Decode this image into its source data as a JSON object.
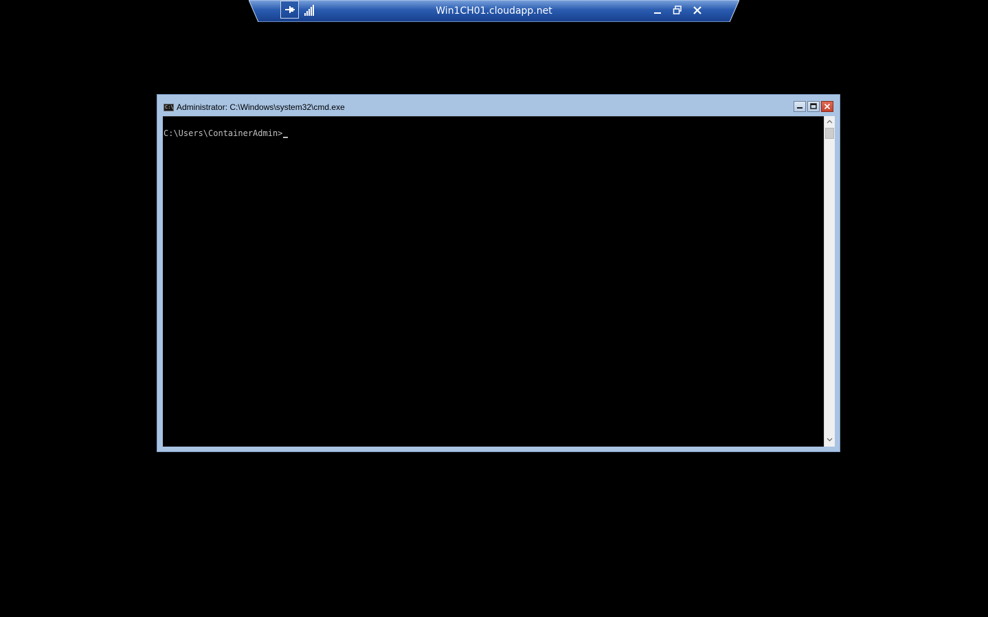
{
  "rdp_bar": {
    "title": "Win1CH01.cloudapp.net",
    "icons": {
      "pin": "pin-icon",
      "signal": "connection-signal-icon",
      "minimize": "minimize-icon",
      "restore": "restore-icon",
      "close": "close-icon"
    },
    "colors": {
      "bar": "#1c4fa0",
      "bar_light": "#6f97d3"
    }
  },
  "cmd_window": {
    "title": "Administrator: C:\\Windows\\system32\\cmd.exe",
    "app_icon_text": "C:\\",
    "prompt": "C:\\Users\\ContainerAdmin>",
    "colors": {
      "frame": "#a9c4e3",
      "console_bg": "#000000",
      "console_text": "#c0c0c0",
      "close_button": "#c7432e"
    },
    "icons": {
      "app": "console-app-icon",
      "minimize": "minimize-icon",
      "maximize": "maximize-icon",
      "close": "close-icon",
      "scroll_up": "chevron-up-icon",
      "scroll_down": "chevron-down-icon"
    }
  }
}
